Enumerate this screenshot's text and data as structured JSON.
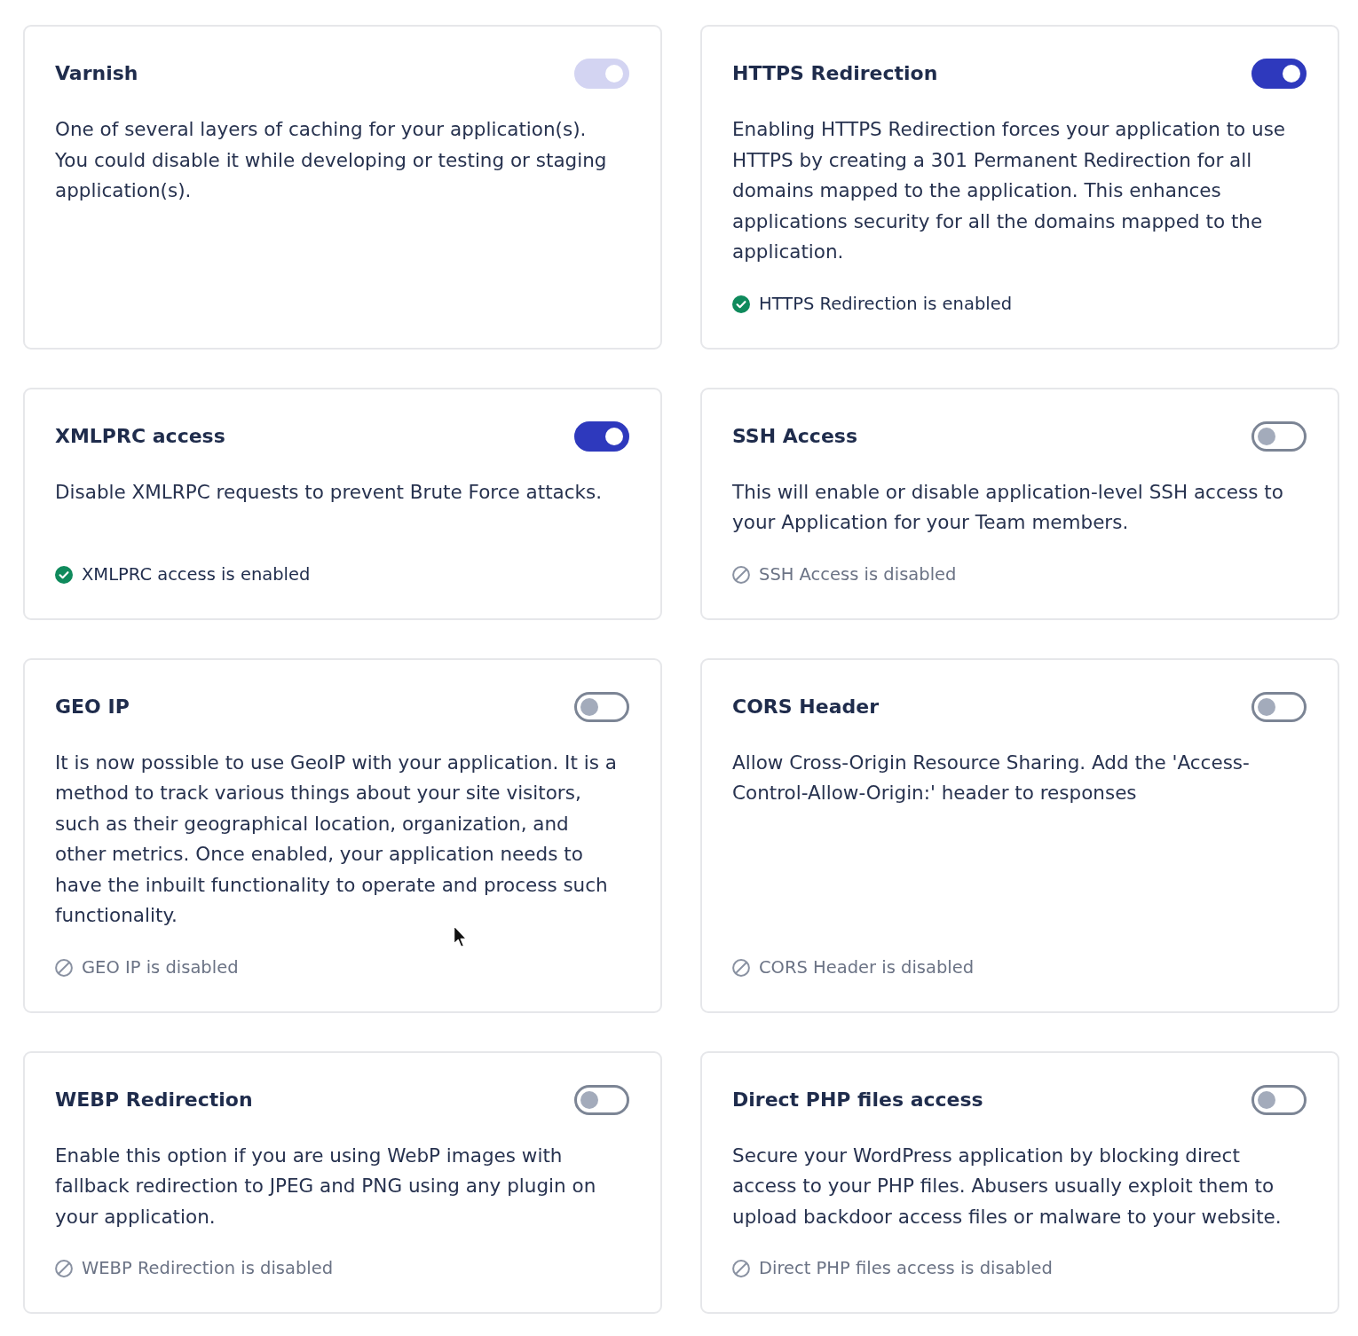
{
  "cards": [
    {
      "title": "Varnish",
      "toggle": {
        "on": true,
        "disabled": true
      },
      "description": "One of several layers of caching for your application(s). You could disable it while developing or testing or staging application(s)."
    },
    {
      "title": "HTTPS Redirection",
      "toggle": {
        "on": true,
        "disabled": false
      },
      "description": "Enabling HTTPS Redirection forces your application to use HTTPS by creating a 301 Permanent Redirection for all domains mapped to the application. This enhances applications security for all the domains mapped to the application.",
      "status": {
        "kind": "enabled",
        "text": "HTTPS Redirection is enabled"
      }
    },
    {
      "title": "XMLPRC access",
      "toggle": {
        "on": true,
        "disabled": false
      },
      "description": "Disable XMLRPC requests to prevent Brute Force attacks.",
      "status": {
        "kind": "enabled",
        "text": "XMLPRC access is enabled"
      }
    },
    {
      "title": "SSH Access",
      "toggle": {
        "on": false,
        "disabled": false
      },
      "description": "This will enable or disable application-level SSH access to your Application for your Team members.",
      "status": {
        "kind": "disabled",
        "text": "SSH Access is disabled"
      }
    },
    {
      "title": "GEO IP",
      "toggle": {
        "on": false,
        "disabled": false
      },
      "description": "It is now possible to use GeoIP with your application. It is a method to track various things about your site visitors, such as their geographical location, organization, and other metrics. Once enabled, your application needs to have the inbuilt functionality to operate and process such functionality.",
      "status": {
        "kind": "disabled",
        "text": "GEO IP is disabled"
      }
    },
    {
      "title": "CORS Header",
      "toggle": {
        "on": false,
        "disabled": false
      },
      "description": "Allow Cross-Origin Resource Sharing. Add the 'Access-Control-Allow-Origin:' header to responses",
      "status": {
        "kind": "disabled",
        "text": "CORS Header is disabled"
      }
    },
    {
      "title": "WEBP Redirection",
      "toggle": {
        "on": false,
        "disabled": false
      },
      "description": "Enable this option if you are using WebP images with fallback redirection to JPEG and PNG using any plugin on your application.",
      "status": {
        "kind": "disabled",
        "text": "WEBP Redirection is disabled"
      }
    },
    {
      "title": "Direct PHP files access",
      "toggle": {
        "on": false,
        "disabled": false
      },
      "description": "Secure your WordPress application by blocking direct access to your PHP files. Abusers usually exploit them to upload backdoor access files or malware to your website.",
      "status": {
        "kind": "disabled",
        "text": "Direct PHP files access is disabled"
      }
    }
  ]
}
